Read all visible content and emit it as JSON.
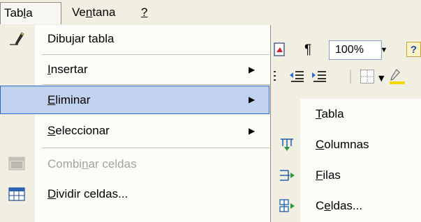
{
  "menubar": {
    "items": [
      {
        "pre": "Tab",
        "u": "l",
        "post": "a"
      },
      {
        "pre": "Ve",
        "u": "n",
        "post": "tana"
      },
      {
        "pre": "",
        "u": "?",
        "post": ""
      }
    ]
  },
  "toolbar": {
    "zoom_value": "100%",
    "pilcrow": "¶",
    "help_glyph": "?"
  },
  "menu": {
    "items": [
      {
        "pre": "Dibu",
        "u": "j",
        "post": "ar tabla",
        "submenu": false,
        "disabled": false,
        "icon": "pencil-icon"
      },
      {
        "pre": "",
        "u": "I",
        "post": "nsertar",
        "submenu": true,
        "disabled": false,
        "icon": ""
      },
      {
        "pre": "",
        "u": "E",
        "post": "liminar",
        "submenu": true,
        "disabled": false,
        "highlighted": true,
        "icon": ""
      },
      {
        "pre": "",
        "u": "S",
        "post": "eleccionar",
        "submenu": true,
        "disabled": false,
        "icon": ""
      },
      {
        "pre": "Combi",
        "u": "n",
        "post": "ar celdas",
        "submenu": false,
        "disabled": true,
        "icon": "merge-cells-icon"
      },
      {
        "pre": "",
        "u": "D",
        "post": "ividir celdas...",
        "submenu": false,
        "disabled": false,
        "icon": "split-cells-icon"
      }
    ]
  },
  "submenu": {
    "items": [
      {
        "pre": "",
        "u": "T",
        "post": "abla",
        "icon": ""
      },
      {
        "pre": "",
        "u": "C",
        "post": "olumnas",
        "icon": "delete-columns-icon"
      },
      {
        "pre": "",
        "u": "F",
        "post": "ilas",
        "icon": "delete-rows-icon"
      },
      {
        "pre": "C",
        "u": "e",
        "post": "ldas...",
        "icon": "delete-cells-icon"
      }
    ]
  },
  "colors": {
    "highlight_bg": "#c1d2ee",
    "highlight_border": "#316ac5",
    "menu_bg": "#fcfcf9",
    "gutter_bg": "#f1efe2",
    "disabled_text": "#a3a29b"
  }
}
